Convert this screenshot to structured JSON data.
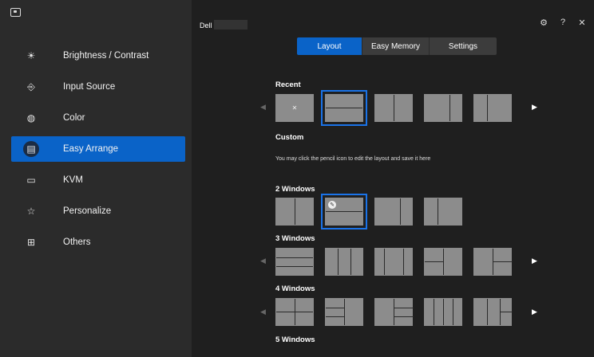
{
  "sidebar": {
    "items": [
      {
        "label": "Brightness / Contrast",
        "icon": "☀",
        "icon_name": "brightness-icon",
        "active": false
      },
      {
        "label": "Input Source",
        "icon": "⎆",
        "icon_name": "input-source-icon",
        "active": false
      },
      {
        "label": "Color",
        "icon": "◍",
        "icon_name": "color-icon",
        "active": false
      },
      {
        "label": "Easy Arrange",
        "icon": "▤",
        "icon_name": "easy-arrange-icon",
        "active": true
      },
      {
        "label": "KVM",
        "icon": "▭",
        "icon_name": "kvm-icon",
        "active": false
      },
      {
        "label": "Personalize",
        "icon": "☆",
        "icon_name": "personalize-icon",
        "active": false
      },
      {
        "label": "Others",
        "icon": "⊞",
        "icon_name": "others-icon",
        "active": false
      }
    ]
  },
  "header": {
    "brand": "Dell",
    "settings_icon": "⚙",
    "help_icon": "?",
    "close_icon": "✕"
  },
  "tabs": [
    "Layout",
    "Easy Memory",
    "Settings"
  ],
  "sections": {
    "recent": "Recent",
    "custom": "Custom",
    "custom_help": "You may click the pencil icon to edit the layout and save it here",
    "two": "2 Windows",
    "three": "3 Windows",
    "four": "4 Windows",
    "five": "5 Windows"
  },
  "icons": {
    "left_arrow": "◀",
    "right_arrow": "▶",
    "clear_mark": "✕",
    "pencil": "✎"
  },
  "colors": {
    "accent": "#0a63c8",
    "selection_outline": "#1a73e8"
  }
}
